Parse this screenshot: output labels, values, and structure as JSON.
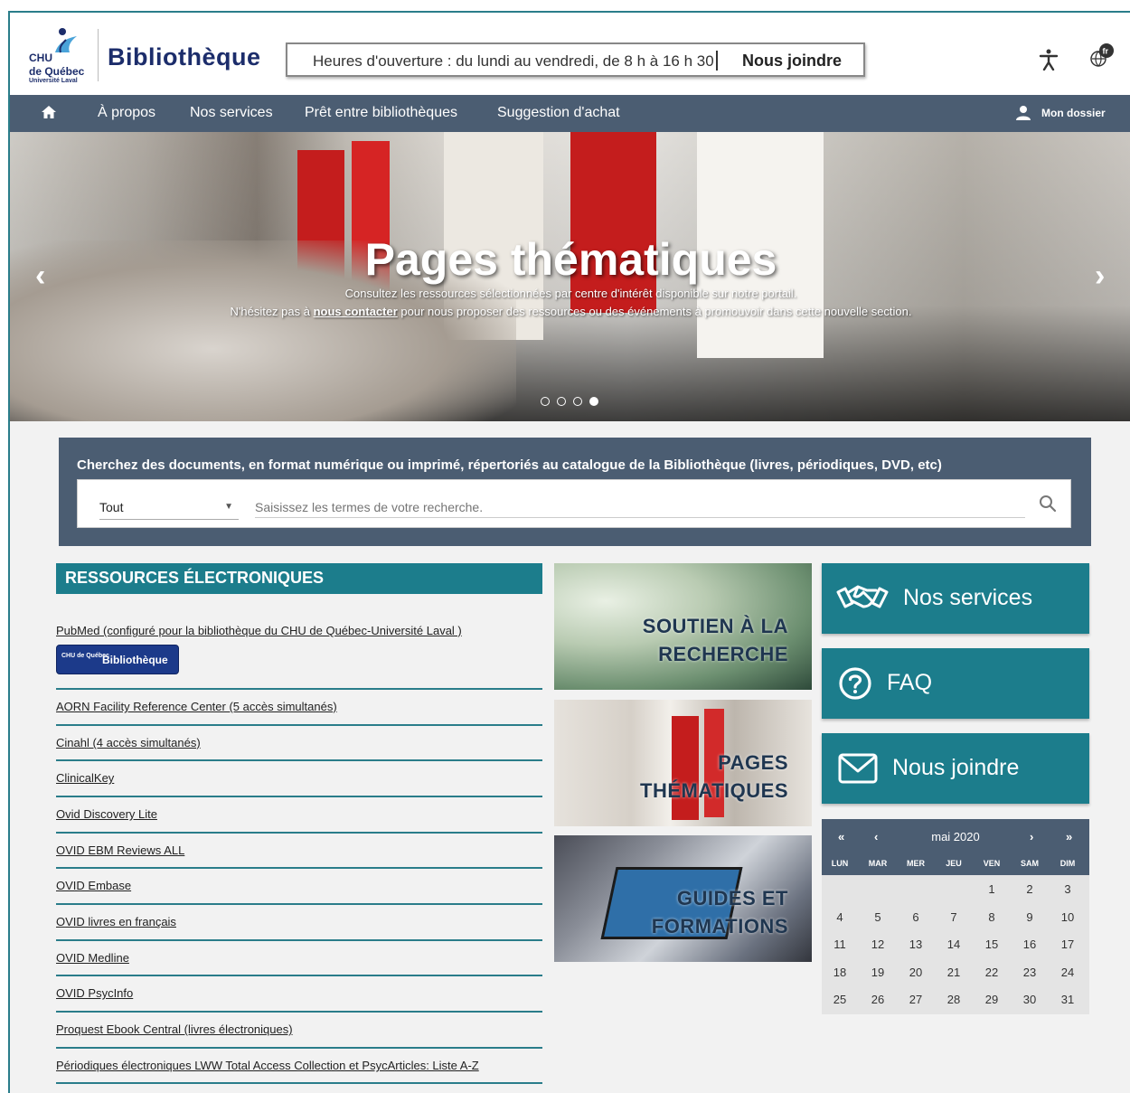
{
  "header": {
    "logo": {
      "line1": "CHU",
      "line2": "de Québec",
      "line3": "Université Laval"
    },
    "brand": "Bibliothèque",
    "hours": "Heures d'ouverture : du lundi au vendredi, de 8 h à 16 h 30",
    "contact_link": "Nous joindre",
    "icons": [
      "accessibility-icon",
      "language-fr-icon"
    ]
  },
  "nav": {
    "items": [
      "À propos",
      "Nos services",
      "Prêt entre bibliothèques",
      "Suggestion d'achat"
    ],
    "dossier": "Mon dossier"
  },
  "hero": {
    "title": "Pages thématiques",
    "line1": "Consultez les ressources sélectionnées par centre d'intérêt disponible sur notre portail.",
    "line2_pre": "N'hésitez pas à ",
    "line2_link": "nous contacter",
    "line2_post": " pour nous proposer des ressources ou des événements à promouvoir dans cette nouvelle section.",
    "slide_count": 4,
    "active_slide": 4
  },
  "search": {
    "label": "Cherchez des documents, en format numérique ou imprimé, répertoriés au catalogue de la Bibliothèque (livres, périodiques, DVD, etc)",
    "scope": "Tout",
    "placeholder": "Saisissez les termes de votre recherche."
  },
  "resources": {
    "title": "RESSOURCES ÉLECTRONIQUES",
    "badge_logo": "CHU de Québec",
    "badge_text": "Bibliothèque",
    "items": [
      "PubMed (configuré pour la bibliothèque du  CHU de Québec-Université Laval )",
      "AORN Facility Reference Center (5 accès simultanés)",
      "Cinahl (4 accès simultanés)",
      "ClinicalKey",
      "Ovid Discovery Lite",
      "OVID EBM Reviews ALL",
      "OVID Embase",
      "OVID livres en français",
      "OVID Medline",
      "OVID PsycInfo",
      "Proquest Ebook Central (livres électroniques)",
      "Périodiques électroniques LWW Total Access Collection et PsycArticles: Liste A-Z"
    ]
  },
  "tiles": [
    {
      "line1": "SOUTIEN À LA",
      "line2": "RECHERCHE"
    },
    {
      "line1": "PAGES",
      "line2": "THÉMATIQUES"
    },
    {
      "line1": "GUIDES ET",
      "line2": "FORMATIONS"
    }
  ],
  "side_buttons": [
    {
      "label": "Nos services",
      "icon": "handshake-icon"
    },
    {
      "label": "FAQ",
      "icon": "question-circle-icon"
    },
    {
      "label": "Nous joindre",
      "icon": "envelope-icon"
    }
  ],
  "calendar": {
    "month": "mai 2020",
    "prev_year": "«",
    "prev_month": "‹",
    "next_month": "›",
    "next_year": "»",
    "dow": [
      "LUN",
      "MAR",
      "MER",
      "JEU",
      "VEN",
      "SAM",
      "DIM"
    ],
    "weeks": [
      [
        "",
        "",
        "",
        "",
        "1",
        "2",
        "3"
      ],
      [
        "4",
        "5",
        "6",
        "7",
        "8",
        "9",
        "10"
      ],
      [
        "11",
        "12",
        "13",
        "14",
        "15",
        "16",
        "17"
      ],
      [
        "18",
        "19",
        "20",
        "21",
        "22",
        "23",
        "24"
      ],
      [
        "25",
        "26",
        "27",
        "28",
        "29",
        "30",
        "31"
      ]
    ]
  },
  "colors": {
    "teal": "#1c7d8c",
    "slate": "#4b5d72",
    "navy": "#1c2d6b"
  }
}
